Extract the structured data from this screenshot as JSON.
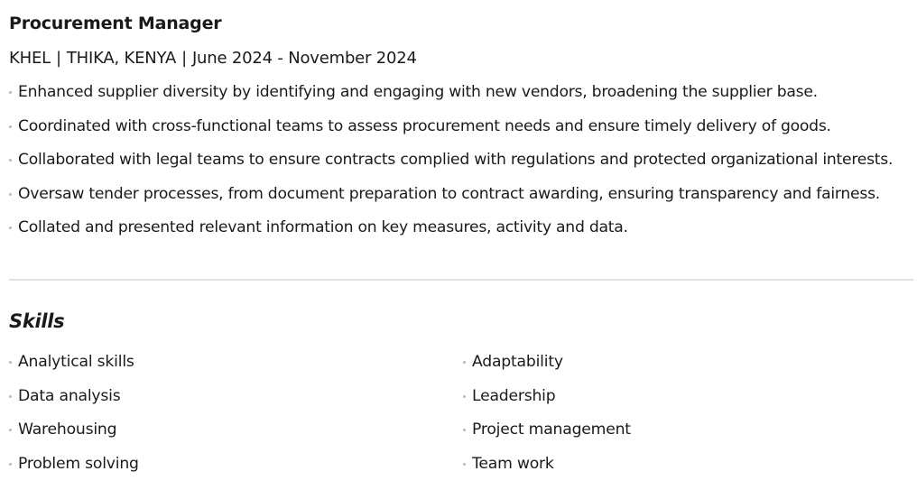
{
  "experience": {
    "title": "Procurement Manager",
    "company": "KHEL",
    "location": "THIKA, KENYA",
    "dates": "June 2024 - November 2024",
    "separator": "|",
    "bullets": [
      "Enhanced supplier diversity by identifying and engaging with new vendors, broadening the supplier base.",
      "Coordinated with cross-functional teams to assess procurement needs and ensure timely delivery of goods.",
      "Collaborated with legal teams to ensure contracts complied with regulations and protected organizational interests.",
      "Oversaw tender processes, from document preparation to contract awarding, ensuring transparency and fairness.",
      "Collated and presented relevant information on key measures, activity and data."
    ]
  },
  "skills": {
    "heading": "Skills",
    "left": [
      "Analytical skills",
      "Data analysis",
      "Warehousing",
      "Problem solving"
    ],
    "right": [
      "Adaptability",
      "Leadership",
      "Project management",
      "Team work"
    ]
  },
  "colors": {
    "text": "#1a1a1a",
    "bullet_dot": "#b8b8b8",
    "divider": "#e2e2e2"
  }
}
